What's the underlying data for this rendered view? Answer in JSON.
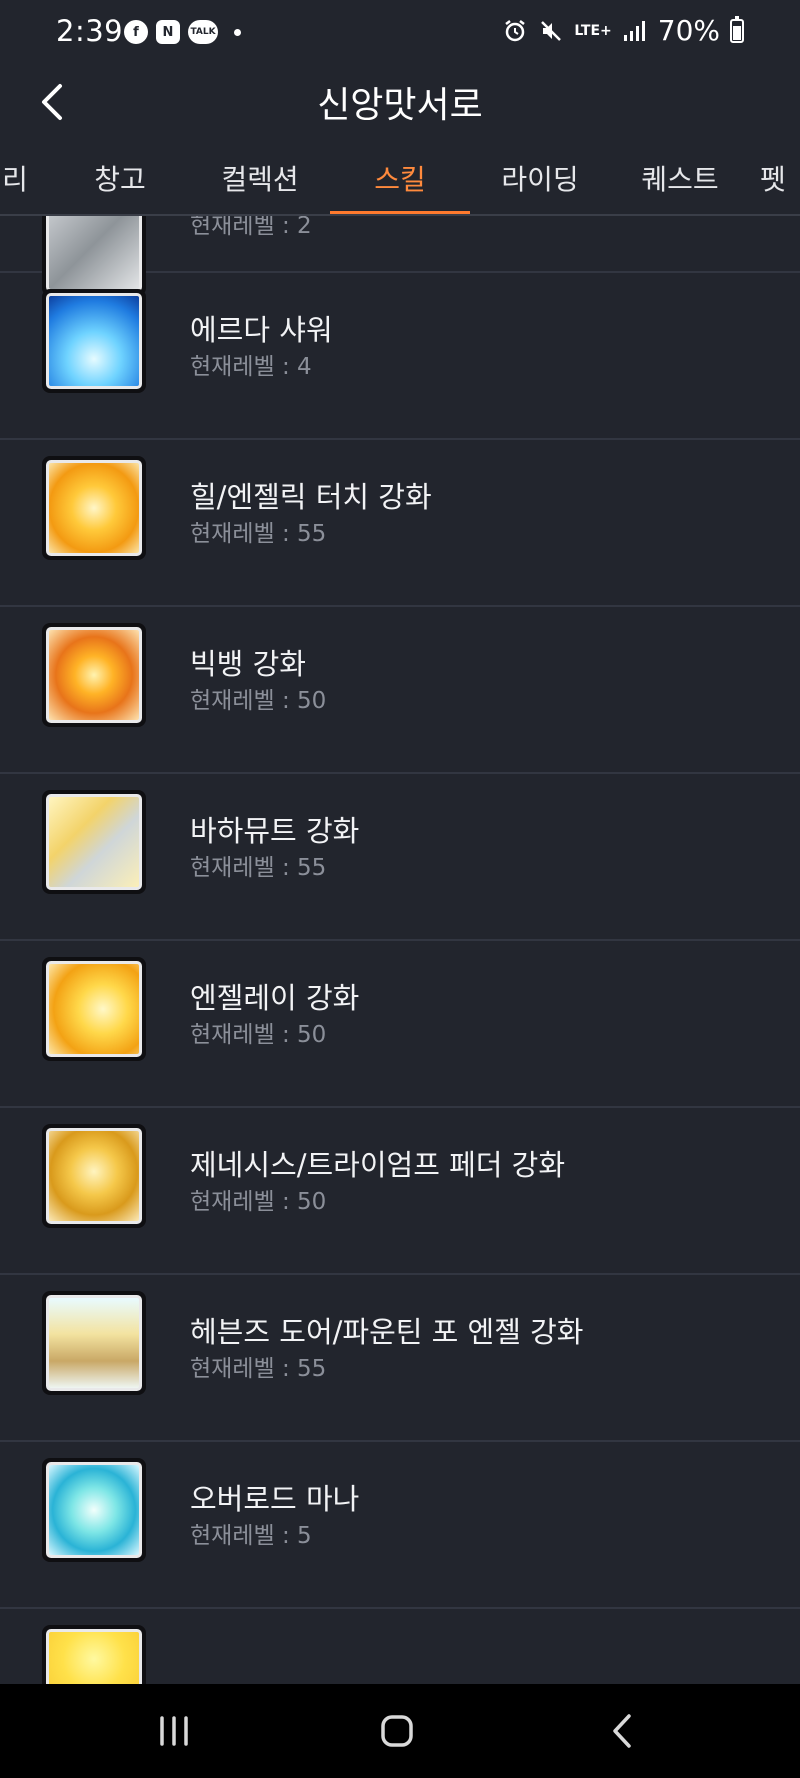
{
  "status_bar": {
    "time": "2:39",
    "app_icons": [
      "facebook-icon",
      "naver-icon",
      "kakaotalk-icon"
    ],
    "talk_label": "TALK",
    "network": "LTE+",
    "battery": "70%"
  },
  "header": {
    "title": "신앙맛서로"
  },
  "tabs": [
    {
      "label": "리"
    },
    {
      "label": "창고"
    },
    {
      "label": "컬렉션"
    },
    {
      "label": "스킬",
      "active": true
    },
    {
      "label": "라이딩"
    },
    {
      "label": "퀘스트"
    },
    {
      "label": "펫"
    }
  ],
  "level_prefix": "현재레벨 : ",
  "skills": [
    {
      "name": "",
      "level": "현재레벨 : 2",
      "icon": "stone-gate-skill-icon"
    },
    {
      "name": "에르다 샤워",
      "level": "현재레벨 : 4",
      "icon": "erda-shower-skill-icon"
    },
    {
      "name": "힐/엔젤릭 터치 강화",
      "level": "현재레벨 : 55",
      "icon": "heal-angelic-touch-skill-icon"
    },
    {
      "name": "빅뱅 강화",
      "level": "현재레벨 : 50",
      "icon": "big-bang-skill-icon"
    },
    {
      "name": "바하뮤트 강화",
      "level": "현재레벨 : 55",
      "icon": "bahamut-skill-icon"
    },
    {
      "name": "엔젤레이 강화",
      "level": "현재레벨 : 50",
      "icon": "angel-ray-skill-icon"
    },
    {
      "name": "제네시스/트라이엄프 페더 강화",
      "level": "현재레벨 : 50",
      "icon": "genesis-triumph-feather-skill-icon"
    },
    {
      "name": "헤븐즈 도어/파운틴 포 엔젤 강화",
      "level": "현재레벨 : 55",
      "icon": "heavens-door-fountain-skill-icon"
    },
    {
      "name": "오버로드 마나",
      "level": "현재레벨 : 5",
      "icon": "overload-mana-skill-icon"
    },
    {
      "name": "",
      "level": "",
      "icon": "partial-skill-icon"
    }
  ],
  "colors": {
    "background": "#22252d",
    "accent": "#ff7a2e",
    "divider": "#323641",
    "muted_text": "#8b8f99"
  },
  "nav_bar": {
    "buttons": [
      "recent-apps-icon",
      "home-icon",
      "back-icon"
    ]
  }
}
